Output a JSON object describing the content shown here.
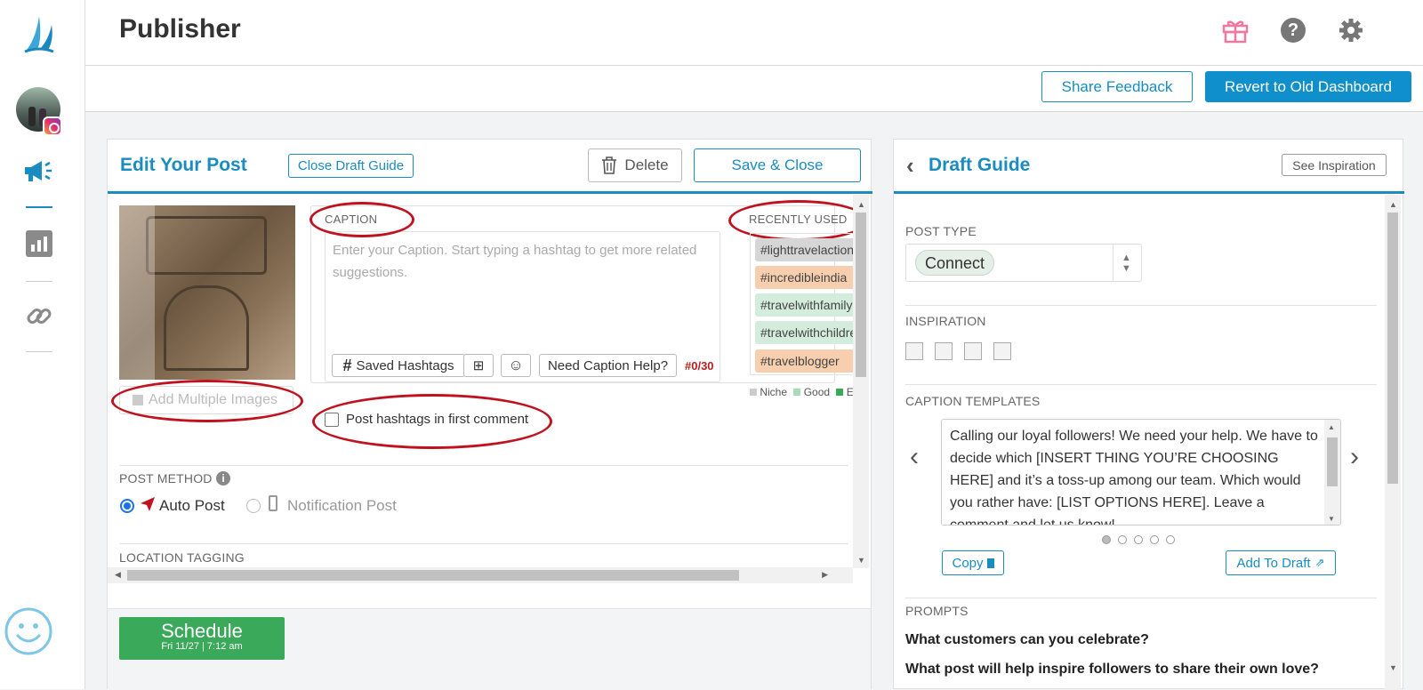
{
  "app": {
    "title": "Publisher"
  },
  "header": {
    "share_feedback": "Share Feedback",
    "revert": "Revert to Old Dashboard"
  },
  "colors": {
    "accent": "#1a8cbf",
    "primary_button": "#0f8fcb",
    "schedule_green": "#3aa95a",
    "annotation_red": "#c0121e"
  },
  "edit_post": {
    "title": "Edit Your Post",
    "close_draft_guide": "Close Draft Guide",
    "delete": "Delete",
    "save_close": "Save & Close",
    "add_multiple_images": "Add Multiple Images",
    "caption_label": "CAPTION",
    "caption_placeholder": "Enter your Caption. Start typing a hashtag to get more related suggestions.",
    "saved_hashtags": "Saved Hashtags",
    "need_caption_help": "Need Caption Help?",
    "hashtag_count": "#0/30",
    "recently_used": "RECENTLY USED",
    "hashtags": [
      {
        "text": "#lighttravelaction",
        "color": "#d6d6d6"
      },
      {
        "text": "#incredibleindia",
        "color": "#f8cfae"
      },
      {
        "text": "#travelwithfamily",
        "color": "#d3ecdc"
      },
      {
        "text": "#travelwithchildren",
        "color": "#d3ecdc"
      },
      {
        "text": "#travelblogger",
        "color": "#f8cfae"
      }
    ],
    "legend": [
      "Niche",
      "Good",
      "E"
    ],
    "first_comment": "Post hashtags in first comment",
    "post_method_label": "POST METHOD",
    "auto_post": "Auto Post",
    "notification_post": "Notification Post",
    "location_tagging": "LOCATION TAGGING",
    "schedule": "Schedule",
    "schedule_time": "Fri 11/27 | 7:12 am"
  },
  "draft_guide": {
    "title": "Draft Guide",
    "see_inspiration": "See Inspiration",
    "post_type_label": "POST TYPE",
    "post_type_value": "Connect",
    "inspiration_label": "INSPIRATION",
    "caption_templates_label": "CAPTION TEMPLATES",
    "template_text": "Calling our loyal followers! We need your help. We have to decide which [INSERT THING YOU’RE CHOOSING HERE] and it’s a toss-up among our team. Which would you rather have: [LIST OPTIONS HERE]. Leave a comment and let us know!",
    "copy": "Copy",
    "add_to_draft": "Add To Draft",
    "prompts_label": "PROMPTS",
    "prompts": [
      "What customers can you celebrate?",
      "What post will help inspire followers to share their own love?"
    ]
  }
}
